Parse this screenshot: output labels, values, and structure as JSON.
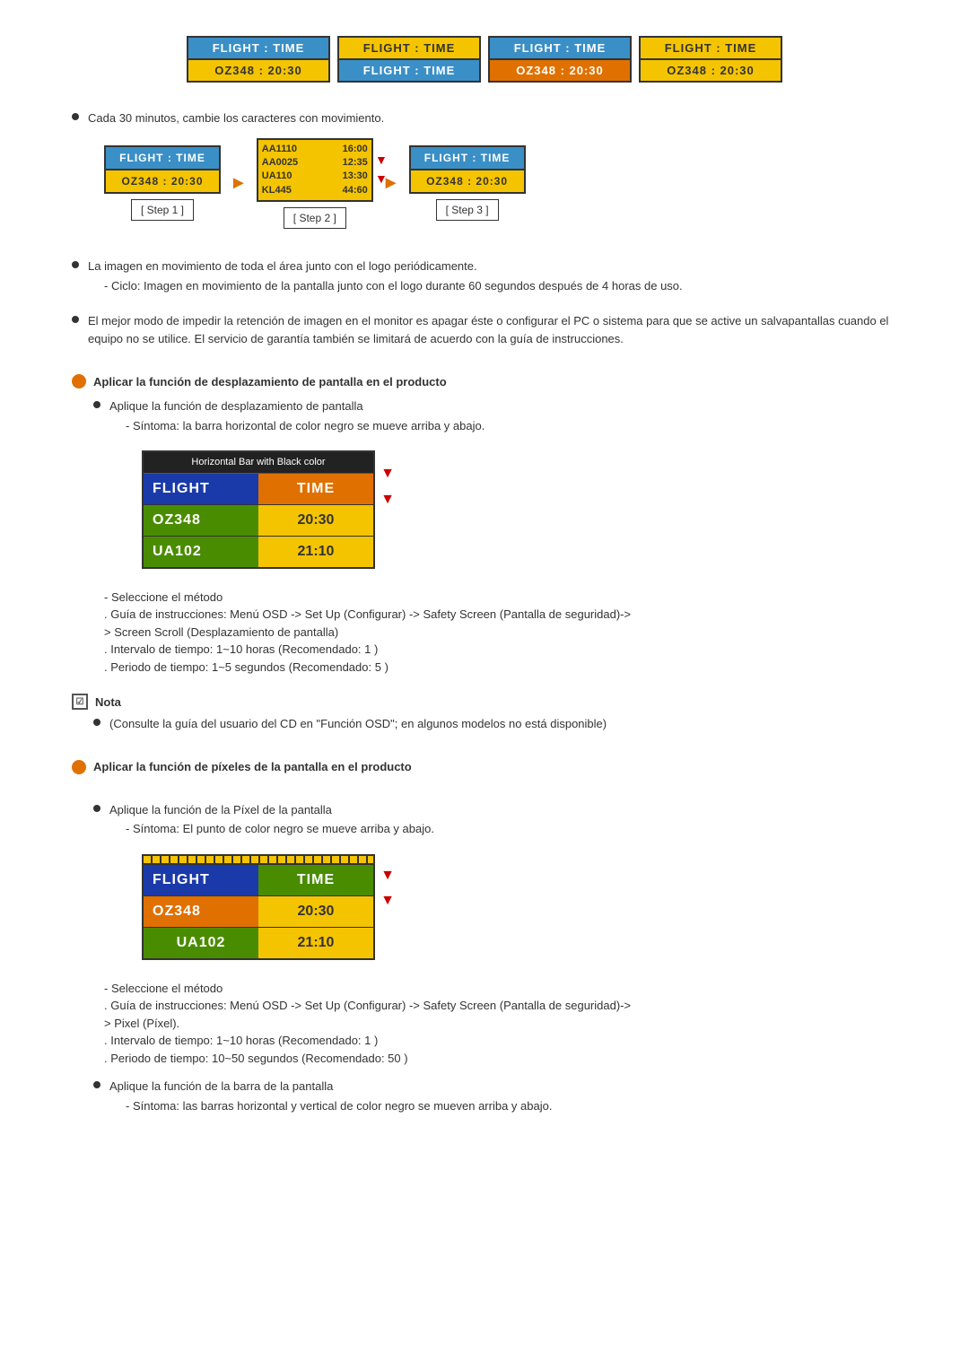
{
  "cards_row1": [
    {
      "header": "FLIGHT  :  TIME",
      "header_style": "blue",
      "body": "OZ348  :  20:30",
      "body_style": "yellow"
    },
    {
      "header": "FLIGHT  :  TIME",
      "header_style": "yellow",
      "body": "FLIGHT  :  TIME",
      "body_style": "blue"
    },
    {
      "header": "FLIGHT  :  TIME",
      "header_style": "blue",
      "body": "OZ348  :  20:30",
      "body_style": "orange"
    },
    {
      "header": "FLIGHT  :  TIME",
      "header_style": "yellow",
      "body": "OZ348  :  20:30",
      "body_style": "yellow"
    }
  ],
  "bullet1": {
    "text": "Cada 30 minutos, cambie los caracteres con movimiento.",
    "steps": [
      {
        "label": "[ Step 1 ]",
        "header": "FLIGHT  :  TIME",
        "body": "OZ348  :  20:30"
      },
      {
        "label": "[ Step 2 ]"
      },
      {
        "label": "[ Step 3 ]",
        "header": "FLIGHT  :  TIME",
        "body": "OZ348  :  20:30"
      }
    ]
  },
  "bullet2": {
    "text": "La imagen en movimiento de toda el área junto con el logo periódicamente.",
    "sub": "- Ciclo: Imagen en movimiento de la pantalla junto con el logo durante 60 segundos después de 4 horas de uso."
  },
  "bullet3": {
    "text": "El mejor modo de impedir la retención de imagen en el monitor es apagar éste o configurar el PC o sistema para que se active un salvapantallas cuando el equipo no se utilice. El servicio de garantía también se limitará de acuerdo con la guía de instrucciones."
  },
  "section1": {
    "title": "Aplicar la función de desplazamiento de pantalla en el producto",
    "bullet1_text": "Aplique la función de desplazamiento de pantalla",
    "bullet1_sub": "- Síntoma: la barra horizontal de color negro se mueve arriba y abajo.",
    "display": {
      "header": "Horizontal Bar with Black color",
      "row1": {
        "left": "FLIGHT",
        "right": "TIME"
      },
      "row2": {
        "left": "OZ348",
        "right": "20:30"
      },
      "row3": {
        "left": "UA102",
        "right": "21:10"
      }
    },
    "method_label": "- Seleccione el método",
    "method_lines": [
      ". Guía de instrucciones: Menú OSD -> Set Up (Configurar) -> Safety Screen (Pantalla de seguridad)->",
      "> Screen Scroll (Desplazamiento de pantalla)",
      ". Intervalo de tiempo: 1~10 horas (Recomendado: 1 )",
      ". Periodo de tiempo: 1~5 segundos (Recomendado: 5 )"
    ]
  },
  "nota": {
    "label": "Nota",
    "bullet": "(Consulte la guía del usuario del CD en \"Función OSD\"; en algunos modelos no está disponible)"
  },
  "section2": {
    "title": "Aplicar la función de píxeles de la pantalla en el producto",
    "bullet1_text": "Aplique la función de la Píxel de la pantalla",
    "bullet1_sub": "- Síntoma: El punto de color negro se mueve arriba y abajo.",
    "display": {
      "row1": {
        "left": "FLIGHT",
        "right": "TIME"
      },
      "row2": {
        "left": "OZ348",
        "right": "20:30"
      },
      "row3": {
        "left": "UA102",
        "right": "21:10"
      }
    },
    "method_label": "- Seleccione el método",
    "method_lines": [
      ". Guía de instrucciones: Menú OSD -> Set Up (Configurar) -> Safety Screen (Pantalla de seguridad)->",
      "> Pixel (Píxel).",
      ". Intervalo de tiempo: 1~10 horas (Recomendado: 1 )",
      ". Periodo de tiempo: 10~50 segundos (Recomendado: 50 )"
    ],
    "bullet2_text": "Aplique la función de la barra de la pantalla",
    "bullet2_sub": "- Síntoma: las barras horizontal y vertical de color negro se mueven arriba y abajo."
  }
}
